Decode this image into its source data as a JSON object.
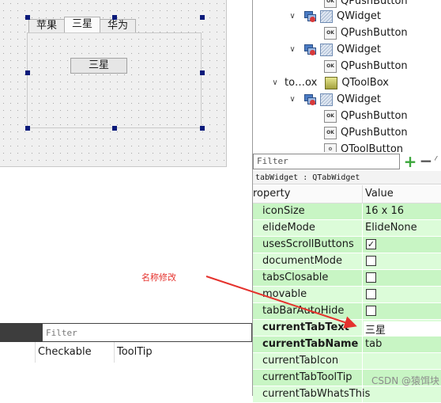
{
  "form": {
    "tabs": [
      "苹果",
      "三星",
      "华为"
    ],
    "active_tab": 1,
    "page_button_label": "三星"
  },
  "object_tree": {
    "rows": [
      {
        "type": "button",
        "label": "QPushButton"
      },
      {
        "type": "widget_group",
        "label": "QWidget",
        "expander": "∨"
      },
      {
        "type": "button",
        "label": "QPushButton"
      },
      {
        "type": "widget_group",
        "label": "QWidget",
        "expander": "∨"
      },
      {
        "type": "button",
        "label": "QPushButton"
      },
      {
        "type": "toolbox",
        "name": "to…ox",
        "label": "QToolBox",
        "expander": "∨"
      },
      {
        "type": "widget_group",
        "label": "QWidget",
        "expander": "∨"
      },
      {
        "type": "button",
        "label": "QPushButton"
      },
      {
        "type": "button",
        "label": "QPushButton"
      },
      {
        "type": "button",
        "label": "QToolButton"
      }
    ]
  },
  "property_editor": {
    "filter_placeholder": "Filter",
    "object_label": "tabWidget : QTabWidget",
    "header_property": "roperty",
    "header_value": "Value",
    "rows": [
      {
        "name": "iconSize",
        "value": "16 x 16",
        "kind": "text"
      },
      {
        "name": "elideMode",
        "value": "ElideNone",
        "kind": "text"
      },
      {
        "name": "usesScrollButtons",
        "value": "✓",
        "kind": "check"
      },
      {
        "name": "documentMode",
        "value": "",
        "kind": "check"
      },
      {
        "name": "tabsClosable",
        "value": "",
        "kind": "check"
      },
      {
        "name": "movable",
        "value": "",
        "kind": "check"
      },
      {
        "name": "tabBarAutoHide",
        "value": "",
        "kind": "check"
      },
      {
        "name": "currentTabText",
        "value": "三星",
        "kind": "text",
        "bold": true
      },
      {
        "name": "currentTabName",
        "value": "tab",
        "kind": "text",
        "bold": true
      },
      {
        "name": "currentTabIcon",
        "value": "",
        "kind": "text"
      },
      {
        "name": "currentTabToolTip",
        "value": "",
        "kind": "text"
      },
      {
        "name": "currentTabWhatsThis",
        "value": "",
        "kind": "text"
      }
    ]
  },
  "action_editor": {
    "filter_placeholder": "Filter",
    "col_checkable": "Checkable",
    "col_tooltip": "ToolTip"
  },
  "annotation": {
    "text": "名称修改",
    "color": "#e5322d"
  },
  "watermark": "CSDN @猿饵块",
  "colors": {
    "property_row": "#c8f5c4",
    "handle": "#0a1a7a"
  }
}
